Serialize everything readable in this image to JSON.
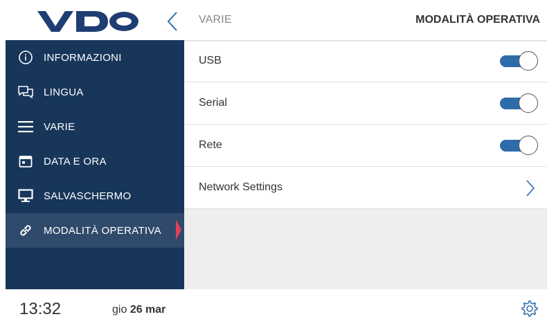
{
  "header": {
    "logo_text": "VDO",
    "breadcrumb": "VARIE",
    "title": "MODALITÀ OPERATIVA"
  },
  "sidebar": {
    "items": [
      {
        "label": "INFORMAZIONI",
        "icon": "info-icon"
      },
      {
        "label": "LINGUA",
        "icon": "chat-icon"
      },
      {
        "label": "VARIE",
        "icon": "menu-icon"
      },
      {
        "label": "DATA E ORA",
        "icon": "calendar-icon"
      },
      {
        "label": "SALVASCHERMO",
        "icon": "monitor-icon"
      },
      {
        "label": "MODALITÀ OPERATIVA",
        "icon": "link-icon",
        "active": true
      }
    ]
  },
  "settings": {
    "rows": [
      {
        "label": "USB",
        "control": "toggle",
        "on": true
      },
      {
        "label": "Serial",
        "control": "toggle",
        "on": true
      },
      {
        "label": "Rete",
        "control": "toggle",
        "on": true
      },
      {
        "label": "Network Settings",
        "control": "chevron-right-icon"
      }
    ]
  },
  "footer": {
    "time": "13:32",
    "day": "gio",
    "date": "26 mar"
  },
  "colors": {
    "sidebar": "#17365a",
    "sidebar_active": "#2f4a6b",
    "accent": "#2e6ca9",
    "active_marker": "#e0405a",
    "logo": "#1e3d73"
  }
}
